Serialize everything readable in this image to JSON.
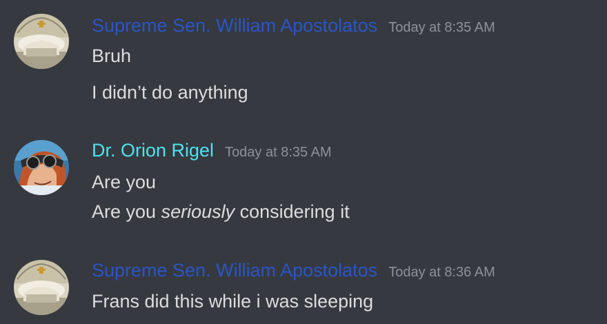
{
  "colors": {
    "background": "#36393f",
    "name_blue": "#2a55c8",
    "name_cyan": "#4de3f0",
    "message_text": "#dcddde",
    "timestamp": "#8e9297"
  },
  "messages": [
    {
      "author": "Supreme Sen. William Apostolatos",
      "timestamp": "Today at 8:35 AM",
      "lines": [
        "Bruh",
        "I didn’t do anything"
      ]
    },
    {
      "author": "Dr. Orion Rigel",
      "timestamp": "Today at 8:35 AM",
      "line1": "Are you",
      "line2_before": "Are you ",
      "line2_emphasis": "seriously",
      "line2_after": " considering it"
    },
    {
      "author": "Supreme Sen. William Apostolatos",
      "timestamp": "Today at 8:36 AM",
      "lines": [
        "Frans did this while i was sleeping"
      ]
    }
  ]
}
